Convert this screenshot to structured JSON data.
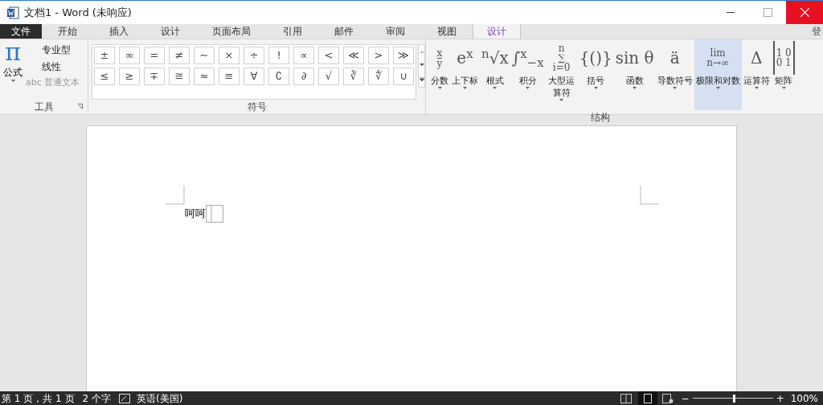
{
  "window": {
    "title": "文档1 - Word (未响应)"
  },
  "tabs": [
    {
      "label": "文件",
      "kind": "file",
      "selected": false
    },
    {
      "label": "开始",
      "kind": "tab",
      "selected": false
    },
    {
      "label": "插入",
      "kind": "tab",
      "selected": false
    },
    {
      "label": "设计",
      "kind": "tab",
      "selected": false
    },
    {
      "label": "页面布局",
      "kind": "tab",
      "selected": false
    },
    {
      "label": "引用",
      "kind": "tab",
      "selected": false
    },
    {
      "label": "邮件",
      "kind": "tab",
      "selected": false
    },
    {
      "label": "审阅",
      "kind": "tab",
      "selected": false
    },
    {
      "label": "视图",
      "kind": "tab",
      "selected": false
    },
    {
      "label": "设计",
      "kind": "context",
      "selected": true
    }
  ],
  "signin": "登",
  "tools": {
    "equation": {
      "glyph": "π",
      "label": "公式"
    },
    "options": [
      {
        "label": "专业型",
        "disabled": false
      },
      {
        "label": "线性",
        "disabled": false
      },
      {
        "label": "abc 普通文本",
        "disabled": true
      }
    ],
    "group_label": "工具"
  },
  "symbols": {
    "rows": [
      [
        "±",
        "∞",
        "=",
        "≠",
        "~",
        "×",
        "÷",
        "!",
        "∝",
        "<",
        "≪",
        ">",
        "≫"
      ],
      [
        "≤",
        "≥",
        "∓",
        "≅",
        "≈",
        "≡",
        "∀",
        "∁",
        "∂",
        "√",
        "∛",
        "∜",
        "∪"
      ]
    ],
    "group_label": "符号"
  },
  "structures": {
    "items": [
      {
        "lines": [
          "x",
          "y"
        ],
        "label": "分数",
        "selected": false
      },
      {
        "lines": [
          "e$^{x}$"
        ],
        "label": "上下标",
        "selected": false
      },
      {
        "lines": [
          "$^{n}$√x"
        ],
        "label": "根式",
        "selected": false
      },
      {
        "lines": [
          "∫$^{x}$$_{−x}$"
        ],
        "label": "积分",
        "selected": false
      },
      {
        "lines": [
          "n",
          "∑",
          "i=0"
        ],
        "label": "大型运算符",
        "selected": false
      },
      {
        "lines": [
          "{()}"
        ],
        "label": "括号",
        "selected": false
      },
      {
        "lines": [
          "sin θ"
        ],
        "label": "函数",
        "selected": false
      },
      {
        "lines": [
          "ä"
        ],
        "label": "导数符号",
        "selected": false
      },
      {
        "lines": [
          "lim",
          "n→∞"
        ],
        "label": "极限和对数",
        "selected": true
      },
      {
        "lines": [
          "Δ"
        ],
        "label": "运算符",
        "selected": false
      },
      {
        "lines": [
          "1 0",
          "0 1"
        ],
        "label": "矩阵",
        "selected": false
      }
    ],
    "group_label": "结构"
  },
  "document": {
    "text": "呵呵"
  },
  "status_bar": {
    "page": "第 1 页，共 1 页",
    "words": "2 个字",
    "language": "英语(美国)",
    "zoom": "100%",
    "zoom_out": "−",
    "zoom_in": "+",
    "zoom_slider": {
      "level": 0.5
    }
  }
}
